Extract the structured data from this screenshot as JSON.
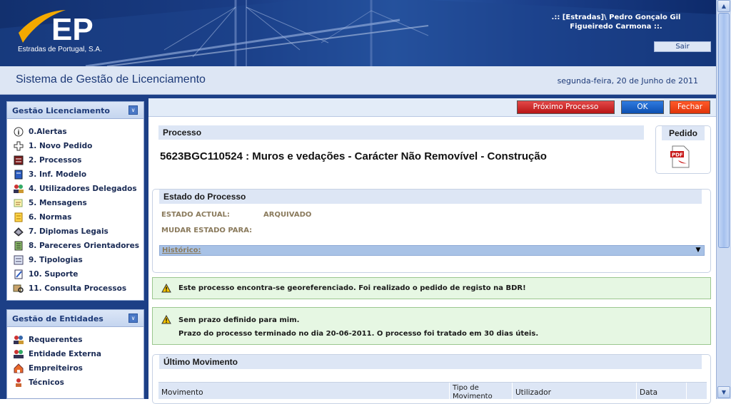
{
  "header": {
    "company_name": "Estradas de Portugal, S.A.",
    "logo_letters": "EP",
    "user_line1": ".:: [Estradas]\\ Pedro Gonçalo Gil",
    "user_line2": "Figueiredo Carmona ::.",
    "logout_label": "Sair"
  },
  "titlebar": {
    "system_title": "Sistema de Gestão de Licenciamento",
    "date": "segunda-feira, 20 de Junho de 2011"
  },
  "sidebar": {
    "licenciamento": {
      "title": "Gestão Licenciamento",
      "items": [
        {
          "label": "0.Alertas",
          "icon": "info-icon"
        },
        {
          "label": "1. Novo Pedido",
          "icon": "plus-icon"
        },
        {
          "label": "2. Processos",
          "icon": "binder-icon"
        },
        {
          "label": "3. Inf. Modelo",
          "icon": "document-icon"
        },
        {
          "label": "4. Utilizadores Delegados",
          "icon": "users-icon"
        },
        {
          "label": "5. Mensagens",
          "icon": "message-icon"
        },
        {
          "label": "6. Normas",
          "icon": "norms-icon"
        },
        {
          "label": "7. Diplomas Legais",
          "icon": "books-icon"
        },
        {
          "label": "8. Pareceres Orientadores",
          "icon": "notepad-icon"
        },
        {
          "label": "9. Tipologias",
          "icon": "list-icon"
        },
        {
          "label": "10. Suporte",
          "icon": "pencil-icon"
        },
        {
          "label": "11. Consulta Processos",
          "icon": "search-process-icon"
        }
      ]
    },
    "entidades": {
      "title": "Gestão de Entidades",
      "items": [
        {
          "label": "Requerentes",
          "icon": "users-icon"
        },
        {
          "label": "Entidade Externa",
          "icon": "user-icon"
        },
        {
          "label": "Empreiteiros",
          "icon": "house-icon"
        },
        {
          "label": "Técnicos",
          "icon": "person-icon"
        }
      ]
    }
  },
  "toolbar": {
    "next_label": "Próximo Processo",
    "ok_label": "OK",
    "close_label": "Fechar"
  },
  "processo": {
    "heading": "Processo",
    "title": "5623BGC110524 : Muros e vedações - Carácter Não Removível - Construção"
  },
  "pedido": {
    "heading": "Pedido",
    "pdf_text": "PDF"
  },
  "estado": {
    "heading": "Estado do Processo",
    "actual_label": "ESTADO ACTUAL:",
    "actual_value": "ARQUIVADO",
    "mudar_label": "MUDAR ESTADO PARA:",
    "historico_label": "Histórico:"
  },
  "notices": {
    "georef": "Este processo encontra-se georeferenciado. Foi realizado o pedido de registo na BDR!",
    "prazo_line1": "Sem prazo definido para mim.",
    "prazo_line2": "Prazo do processo terminado no dia 20-06-2011. O processo foi tratado em 30 dias úteis."
  },
  "ultimo": {
    "heading": "Último Movimento",
    "columns": [
      "Movimento",
      "Tipo de Movimento",
      "Utilizador",
      "Data"
    ]
  },
  "colors": {
    "accent_blue": "#1c3f86",
    "title_text": "#1d3a78",
    "notice_green": "#e6f7e3"
  }
}
